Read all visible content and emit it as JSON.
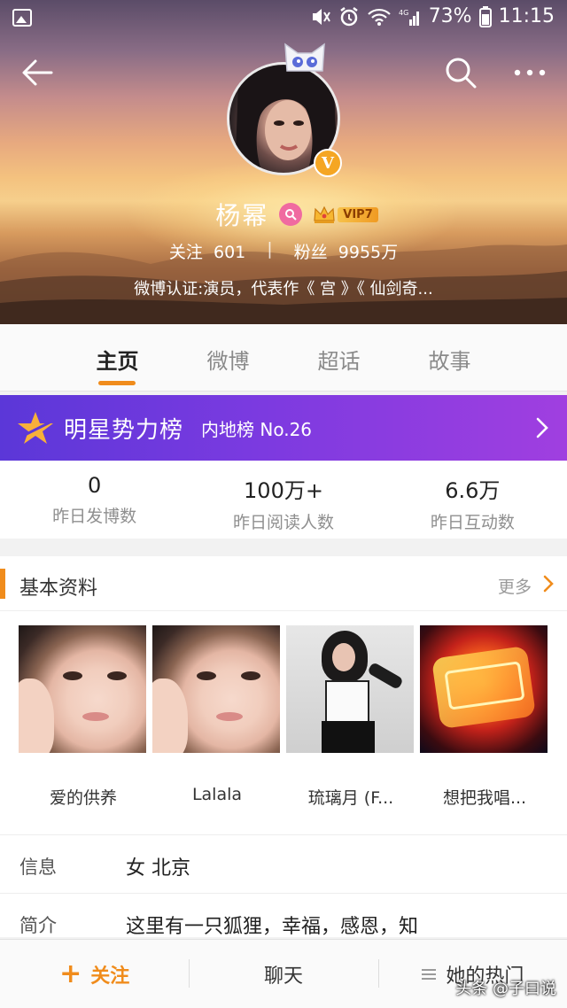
{
  "status_bar": {
    "battery": "73%",
    "time": "11:15",
    "network": "4G"
  },
  "profile": {
    "name": "杨幂",
    "vip_label": "VIP7",
    "following_label": "关注",
    "following_count": "601",
    "followers_label": "粉丝",
    "followers_count": "9955万",
    "verification": "微博认证:演员，代表作《 宫 》《 仙剑奇..."
  },
  "tabs": [
    {
      "label": "主页",
      "active": true
    },
    {
      "label": "微博",
      "active": false
    },
    {
      "label": "超话",
      "active": false
    },
    {
      "label": "故事",
      "active": false
    }
  ],
  "rank_banner": {
    "title": "明星势力榜",
    "subtitle": "内地榜 No.26"
  },
  "stats": [
    {
      "value": "0",
      "label": "昨日发博数"
    },
    {
      "value": "100万+",
      "label": "昨日阅读人数"
    },
    {
      "value": "6.6万",
      "label": "昨日互动数"
    }
  ],
  "basic_info": {
    "title": "基本资料",
    "more": "更多",
    "works": [
      {
        "caption": "爱的供养"
      },
      {
        "caption": "Lalala"
      },
      {
        "caption": "琉璃月 (F..."
      },
      {
        "caption": "想把我唱..."
      }
    ],
    "rows": [
      {
        "label": "信息",
        "value": "女  北京"
      },
      {
        "label": "简介",
        "value": "这里有一只狐狸，幸福，感恩，知"
      }
    ]
  },
  "bottom_bar": {
    "follow": "关注",
    "chat": "聊天",
    "hot": "她的热门"
  },
  "watermark": "头条 @子曰说",
  "colors": {
    "accent": "#f08c1c",
    "rank_start": "#5b37d8",
    "rank_end": "#a03fe0"
  }
}
